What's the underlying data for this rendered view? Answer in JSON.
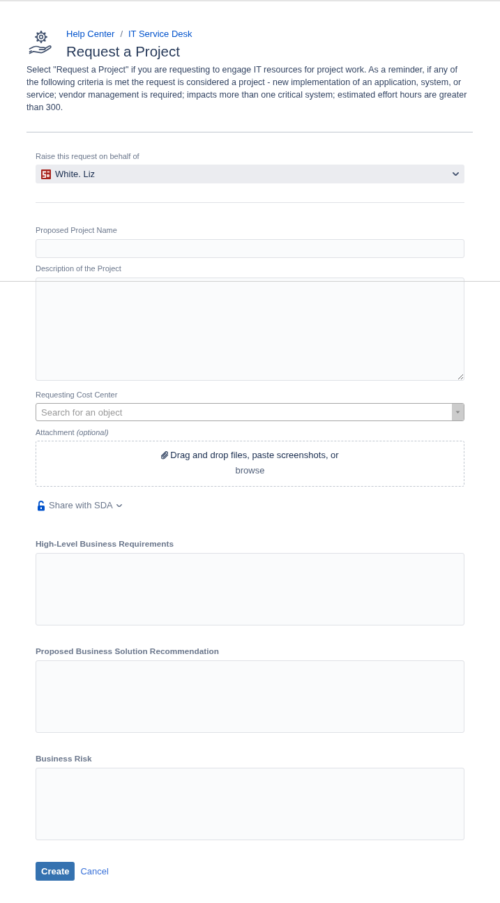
{
  "header": {
    "breadcrumbs": [
      {
        "label": "Help Center"
      },
      {
        "label": "IT Service Desk"
      }
    ],
    "separator": "/",
    "title": "Request a Project",
    "description": "Select \"Request a Project\" if you are requesting to engage IT resources for project work. As a reminder, if any of the following criteria is met the request is considered a project - new implementation of an application, system, or service; vendor management is required; impacts more than one critical system; estimated effort hours are greater than 300."
  },
  "on_behalf": {
    "label": "Raise this request on behalf of",
    "value": "White. Liz"
  },
  "fields": [
    {
      "kind": "input",
      "label": "Proposed Project Name"
    },
    {
      "kind": "textarea",
      "label": "Description of the Project"
    },
    {
      "kind": "select",
      "label": "Requesting Cost Center",
      "placeholder": "Search for an object"
    },
    {
      "kind": "attachment",
      "label": "Attachment *(optional)*",
      "prompt": "Drag and drop files, paste screenshots, or",
      "link": "browse"
    }
  ],
  "share": {
    "label": "Share with SDA"
  },
  "sections": [
    {
      "label": "High-Level Business Requirements"
    },
    {
      "label": "Proposed Business Solution Recommendation"
    },
    {
      "label": "Business Risk"
    }
  ],
  "actions": {
    "submit": "Create",
    "cancel": "Cancel"
  }
}
